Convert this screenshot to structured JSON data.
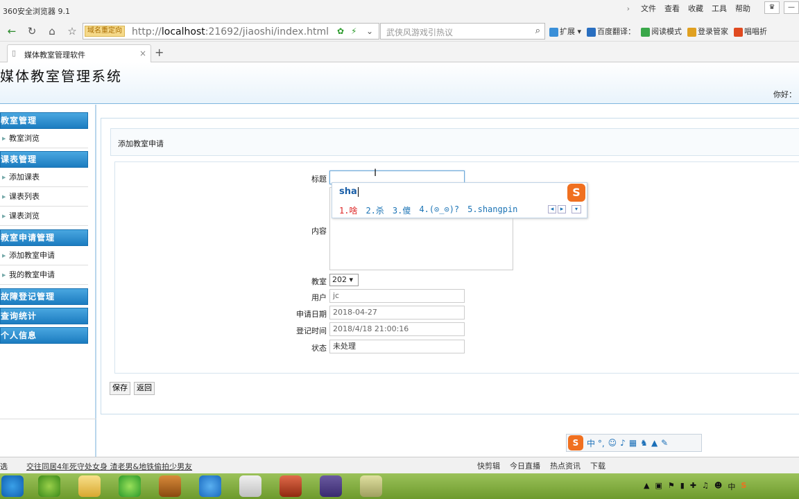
{
  "browser": {
    "title": "360安全浏览器 9.1",
    "menu": [
      "文件",
      "查看",
      "收藏",
      "工具",
      "帮助"
    ],
    "redirect_badge": "域名重定向",
    "url_prefix": "http://",
    "url_host": "localhost",
    "url_rest": ":21692/jiaoshi/index.html",
    "search_placeholder": "武侠风游戏引热议",
    "tools": [
      "扩展",
      "百度翻译：",
      "阅读模式",
      "登录管家",
      "唱唱折"
    ],
    "tab_label": "媒体教室管理软件",
    "tab_close": "×",
    "new_tab": "+"
  },
  "page": {
    "system_title": "媒体教室管理系统",
    "greeting": "你好："
  },
  "sidebar": {
    "groups": [
      {
        "label": "教室管理",
        "items": [
          "教室浏览"
        ]
      },
      {
        "label": "课表管理",
        "items": [
          "添加课表",
          "课表列表",
          "课表浏览"
        ]
      },
      {
        "label": "教室申请管理",
        "items": [
          "添加教室申请",
          "我的教室申请"
        ]
      },
      {
        "label": "故障登记管理",
        "items": []
      },
      {
        "label": "查询统计",
        "items": []
      },
      {
        "label": "个人信息",
        "items": []
      }
    ]
  },
  "main": {
    "breadcrumb": "添加教室申请",
    "form": {
      "title_label": "标题",
      "title_value": "",
      "content_label": "内容",
      "classroom_label": "教室",
      "classroom_value": "202 ▾",
      "user_label": "用户",
      "user_value": "jc",
      "apply_date_label": "申请日期",
      "apply_date_value": "2018-04-27",
      "register_time_label": "登记时间",
      "register_time_value": "2018/4/18 21:00:16",
      "status_label": "状态",
      "status_value": "未处理"
    },
    "save_button": "保存",
    "back_button": "返回"
  },
  "ime": {
    "composition": "sha",
    "candidates": [
      "1.啥",
      "2.杀",
      "3.傻",
      "4.(⊙_⊙)?",
      "5.shangpin"
    ],
    "logo": "S",
    "bar_text": "中 °,"
  },
  "statusbar": {
    "left": "选",
    "news": "交往同居4年死守处女身 渣老男&地铁偷拍少男友",
    "right": [
      "快剪辑",
      "今日直播",
      "热点资讯",
      "下载"
    ]
  },
  "taskbar": {
    "tray_text": "中"
  },
  "colors": {
    "sidebar_header": "#1c7cc0",
    "ime_orange": "#f07020",
    "taskbar_green": "#7aa63a"
  }
}
